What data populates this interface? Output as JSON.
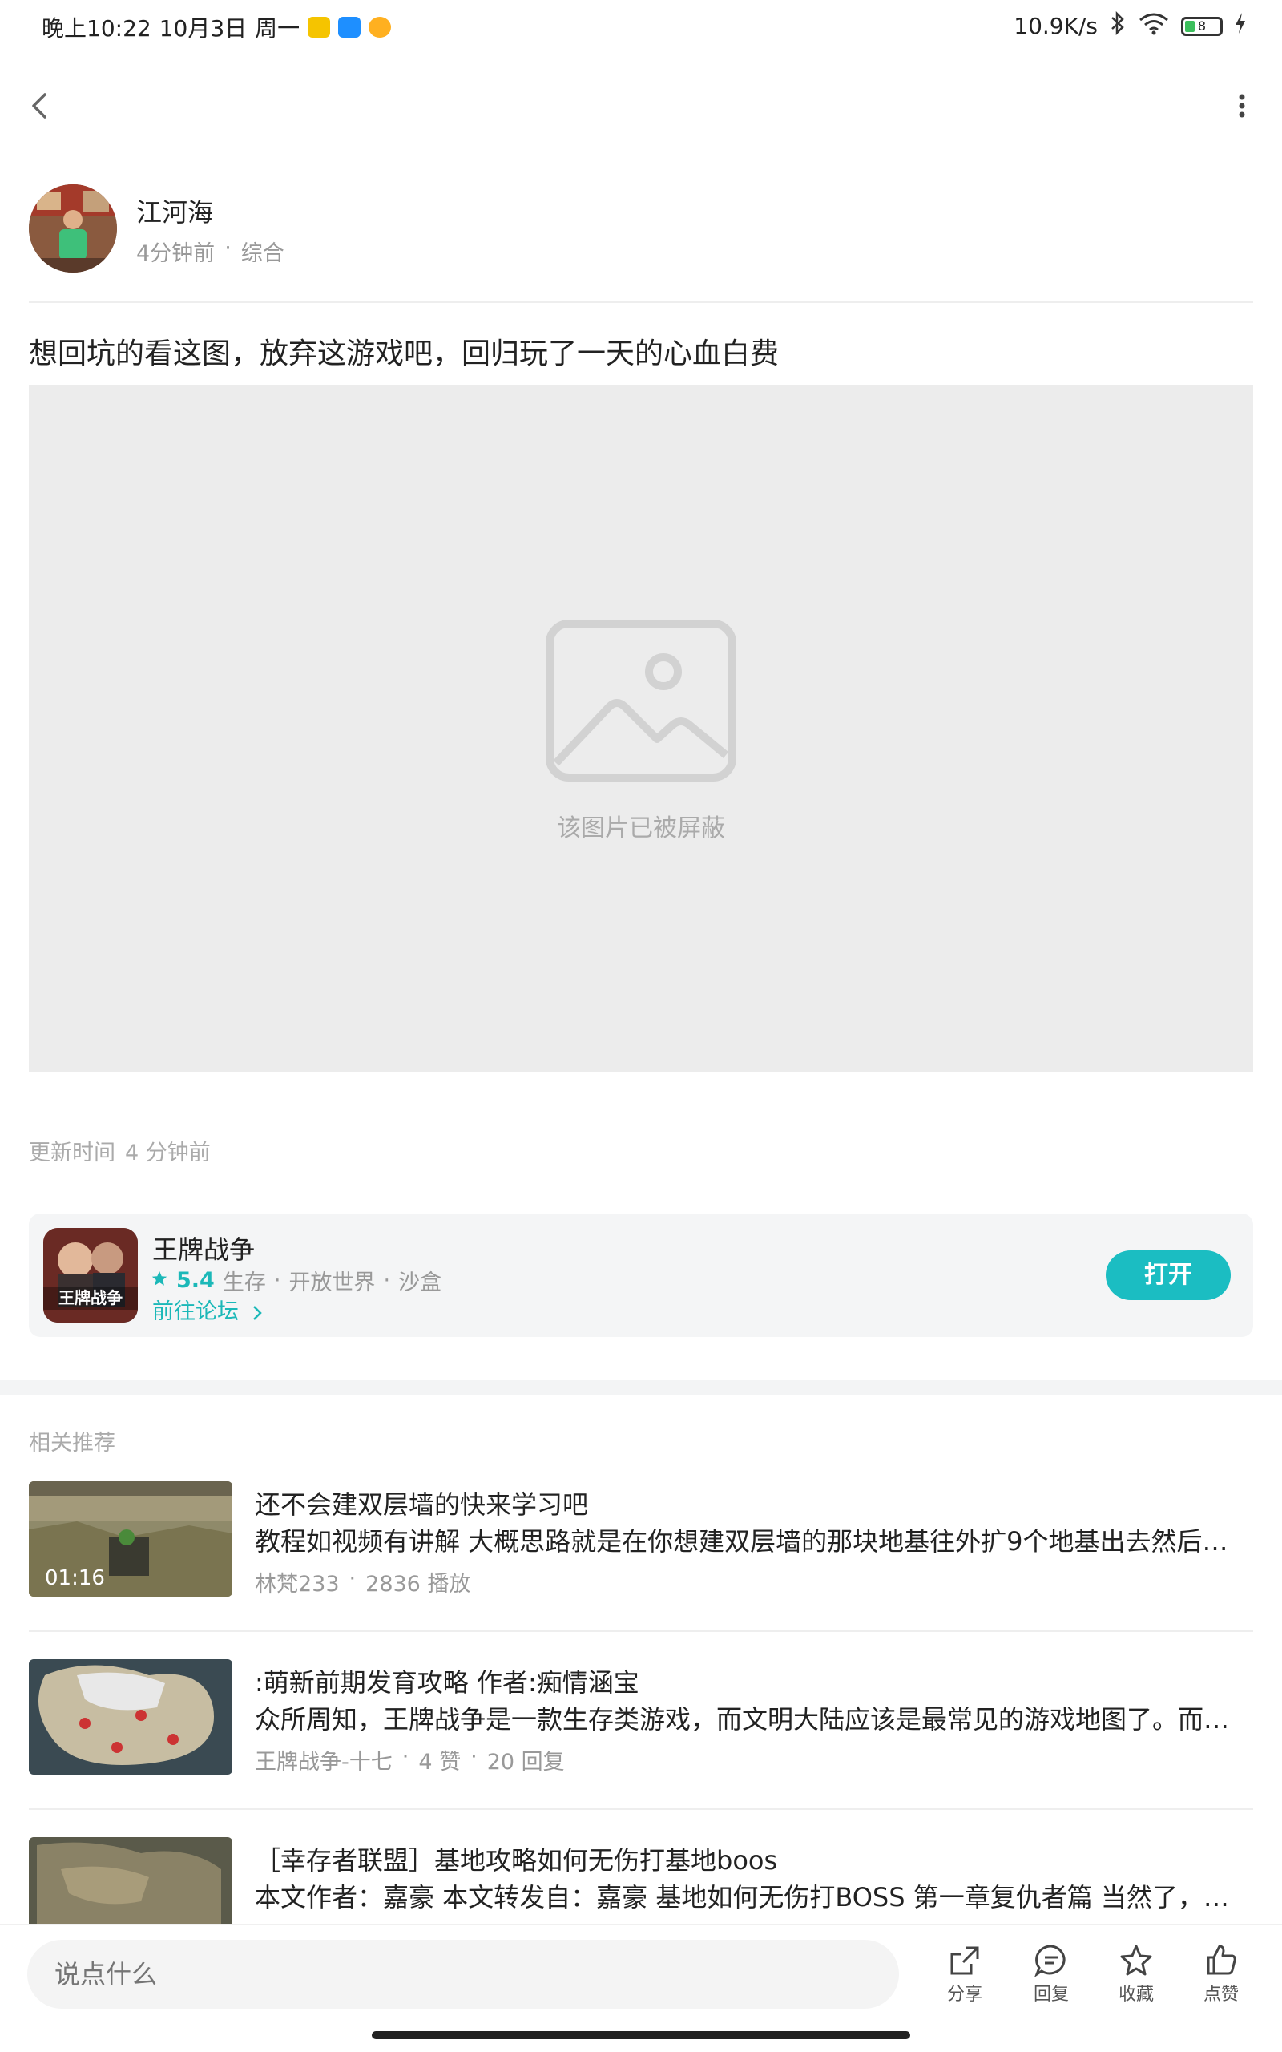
{
  "status_bar": {
    "time": "晚上10:22",
    "date": "10月3日",
    "weekday": "周一",
    "network_speed": "10.9K/s",
    "battery": "8"
  },
  "post": {
    "author_name": "江河海",
    "posted_ago": "4分钟前",
    "category": "综合",
    "title": "想回坑的看这图，放弃这游戏吧，回归玩了一天的心血白费",
    "blocked_text": "该图片已被屏蔽",
    "update_label": "更新时间",
    "update_value": "4 分钟前"
  },
  "game": {
    "name": "王牌战争",
    "rating": "5.4",
    "tags": [
      "生存",
      "开放世界",
      "沙盒"
    ],
    "forum_link": "前往论坛",
    "open_label": "打开"
  },
  "recommend": {
    "label": "相关推荐",
    "items": [
      {
        "title": "还不会建双层墙的快来学习吧",
        "desc": "教程如视频有讲解 大概思路就是在你想建双层墙的那块地基往外扩9个地基出去然后延伸…",
        "meta": [
          "林梵233",
          "2836 播放"
        ],
        "duration": "01:16"
      },
      {
        "title": ":萌新前期发育攻略 作者:痴情涵宝",
        "desc": "众所周知，王牌战争是一款生存类游戏，而文明大陆应该是最常见的游戏地图了。而…",
        "meta": [
          "王牌战争-十七",
          "4 赞",
          "20 回复"
        ]
      },
      {
        "title": "［幸存者联盟］基地攻略如何无伤打基地boos",
        "desc": "本文作者：嘉豪 本文转发自：嘉豪 基地如何无伤打BOSS 第一章复仇者篇 当然了，大…"
      }
    ]
  },
  "bottom_bar": {
    "comment_placeholder": "说点什么",
    "share": "分享",
    "reply": "回复",
    "favorite": "收藏",
    "like": "点赞"
  },
  "colors": {
    "accent": "#1bbdc2",
    "blocked_bg": "#ececec"
  }
}
